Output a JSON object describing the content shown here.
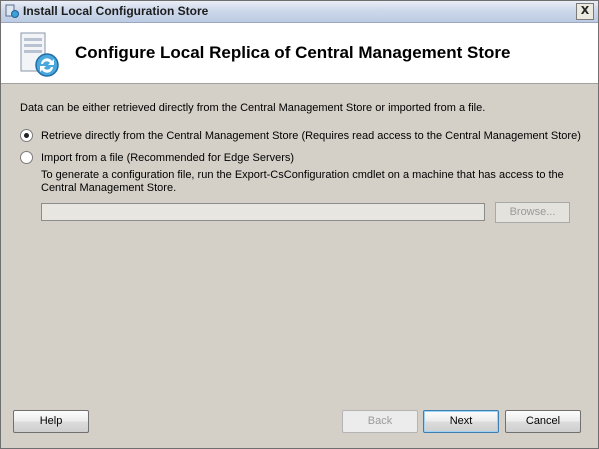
{
  "window": {
    "title": "Install Local Configuration Store",
    "close_label": "X"
  },
  "header": {
    "title": "Configure Local Replica of Central Management Store"
  },
  "content": {
    "intro": "Data can be either retrieved directly from the Central Management Store or imported from a file.",
    "option_retrieve": "Retrieve directly from the Central Management Store (Requires read access to the Central Management Store)",
    "option_import": "Import from a file (Recommended for Edge Servers)",
    "hint": "To generate a configuration file, run the Export-CsConfiguration cmdlet on a machine that has access to the Central Management Store.",
    "file_path_value": "",
    "browse_label": "Browse...",
    "selected_option": "retrieve"
  },
  "buttons": {
    "help": "Help",
    "back": "Back",
    "next": "Next",
    "cancel": "Cancel"
  }
}
